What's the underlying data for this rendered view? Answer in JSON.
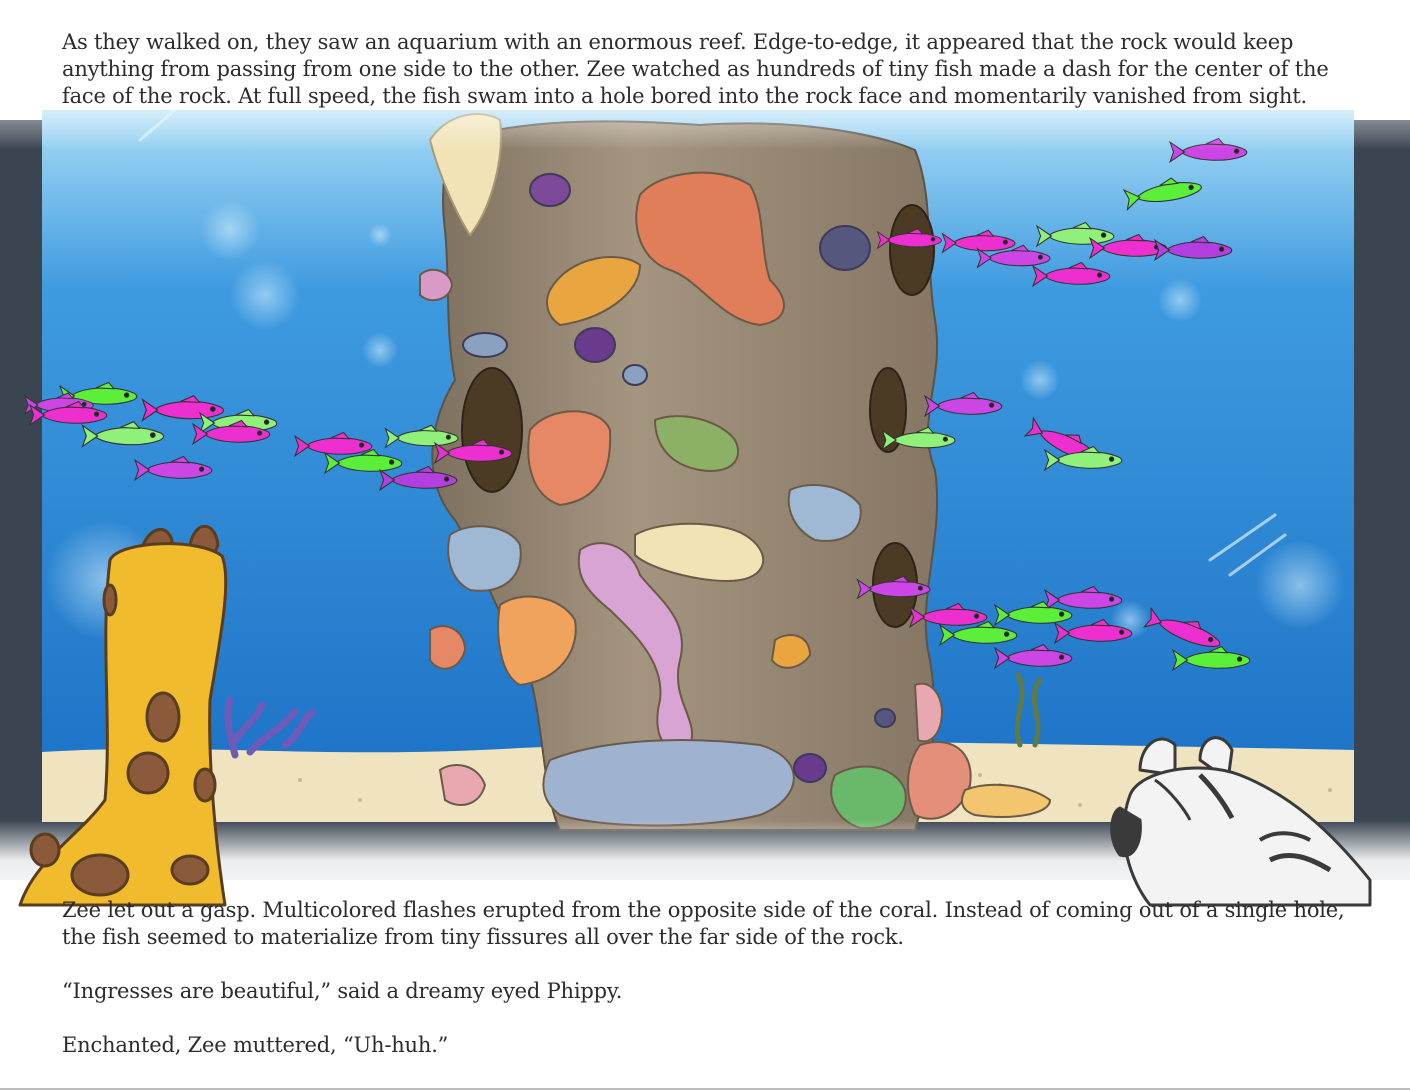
{
  "story": {
    "top_paragraph_lines": [
      "As they walked on, they saw an aquarium with an enormous reef. Edge-to-edge, it appeared that the rock would keep",
      "anything from passing from one side to the other. Zee watched as hundreds of tiny fish made a dash for the center of the",
      "face of the rock. At full speed, the fish swam into a hole bored into the rock face and momentarily vanished from sight."
    ],
    "bottom_paragraph_lines": [
      "Zee let out a gasp. Multicolored flashes erupted from the opposite side of the coral. Instead of coming out of a single hole,",
      "the fish seemed to materialize from tiny fissures all over the far side of the rock."
    ],
    "quote_line": "“Ingresses are beautiful,” said a dreamy eyed Phippy.",
    "closing_line": "Enchanted, Zee muttered, “Uh-huh.”"
  },
  "colors": {
    "water": "#1f7fd4",
    "water_light": "#8fd1f7",
    "sand": "#efe4bf",
    "rock": "#9a8a76",
    "tank_frame": "#3b4552",
    "giraffe": "#f0bb2c",
    "giraffe_spot": "#8a5a3a",
    "fish_magenta": "#ee2fd0",
    "fish_green": "#5cef3a",
    "fish_purple": "#b43fe0"
  }
}
